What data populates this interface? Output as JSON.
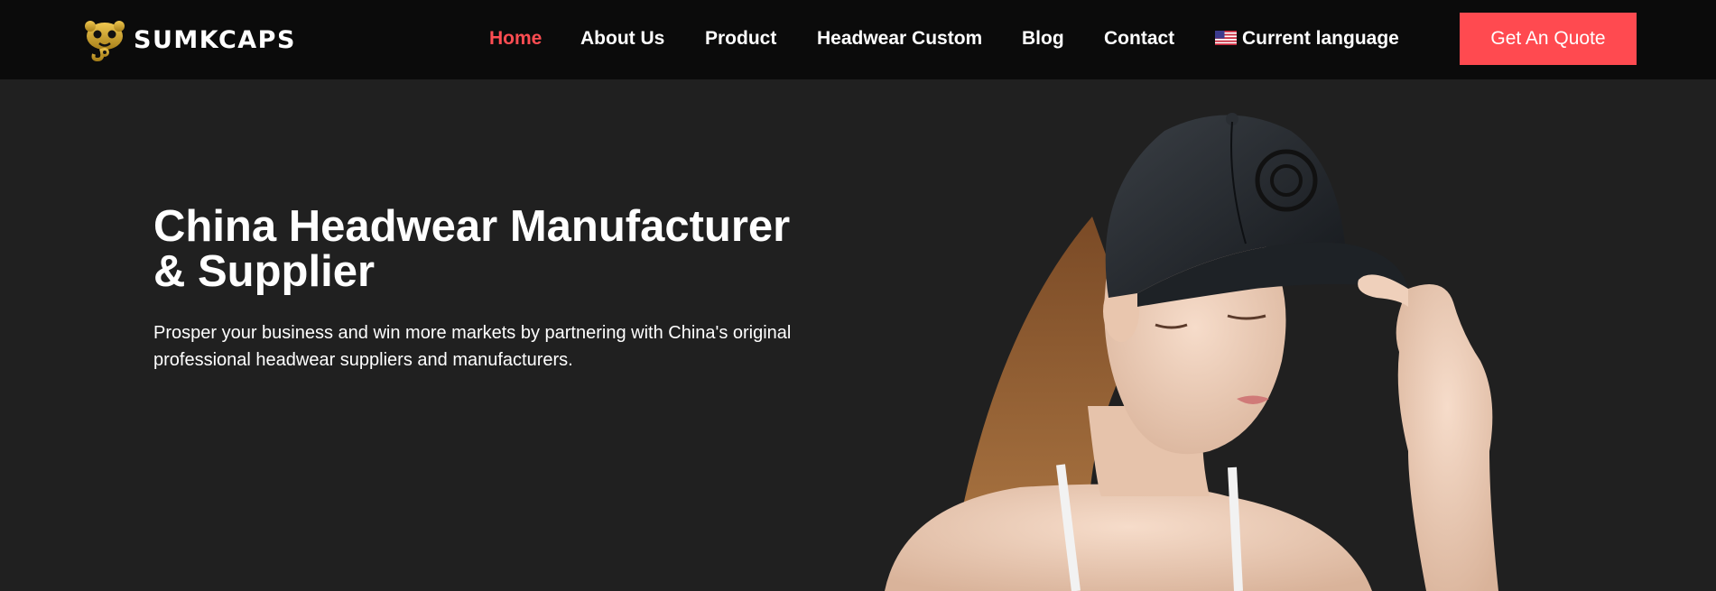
{
  "brand": {
    "name": "SUMKCAPS",
    "logo_icon": "skull-cap-logo-icon"
  },
  "nav": {
    "items": [
      {
        "label": "Home",
        "active": true
      },
      {
        "label": "About Us",
        "active": false
      },
      {
        "label": "Product",
        "active": false
      },
      {
        "label": "Headwear Custom",
        "active": false
      },
      {
        "label": "Blog",
        "active": false
      },
      {
        "label": "Contact",
        "active": false
      }
    ],
    "language": {
      "label": "Current language",
      "icon": "us-flag-icon"
    }
  },
  "header": {
    "cta_label": "Get An Quote"
  },
  "hero": {
    "title_line1": "China Headwear Manufacturer",
    "title_line2": "& Supplier",
    "subtitle_line1": "Prosper your business and win more markets by partnering with China's original",
    "subtitle_line2": "professional headwear suppliers and manufacturers."
  },
  "colors": {
    "header_bg": "#0b0b0b",
    "page_bg": "#202020",
    "accent": "#ff4a50",
    "active_nav": "#ff4d52",
    "logo_gold": "#c9a227"
  }
}
